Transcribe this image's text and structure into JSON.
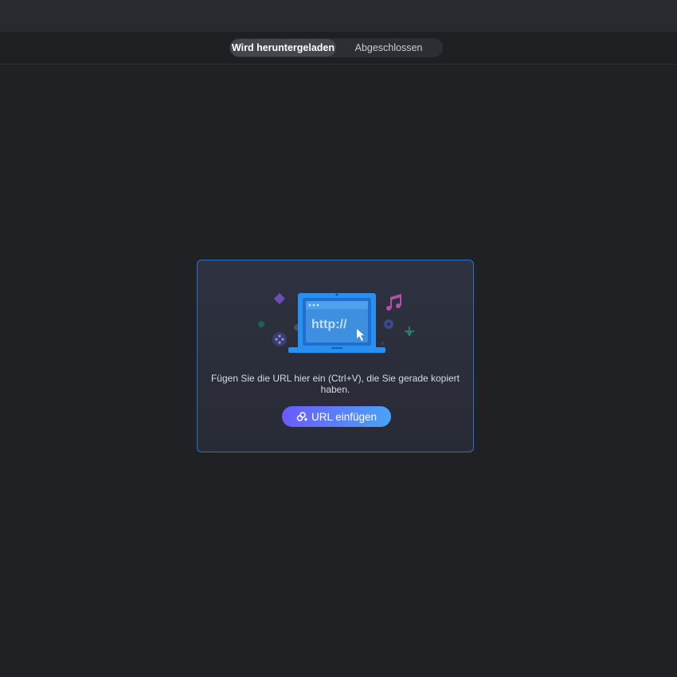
{
  "tabs": {
    "downloading_label": "Wird heruntergeladen",
    "completed_label": "Abgeschlossen"
  },
  "dropzone": {
    "illustration_text": "http://",
    "hint": "Fügen Sie die URL hier ein (Ctrl+V), die Sie gerade kopiert haben.",
    "paste_button_label": "URL einfügen",
    "paste_button_icon": "link-plus-icon"
  },
  "colors": {
    "background": "#202124",
    "accent_border": "#2f6fc7",
    "button_gradient_start": "#6a5bff",
    "button_gradient_end": "#4aa3f5",
    "laptop_blue": "#2b8ff0"
  }
}
